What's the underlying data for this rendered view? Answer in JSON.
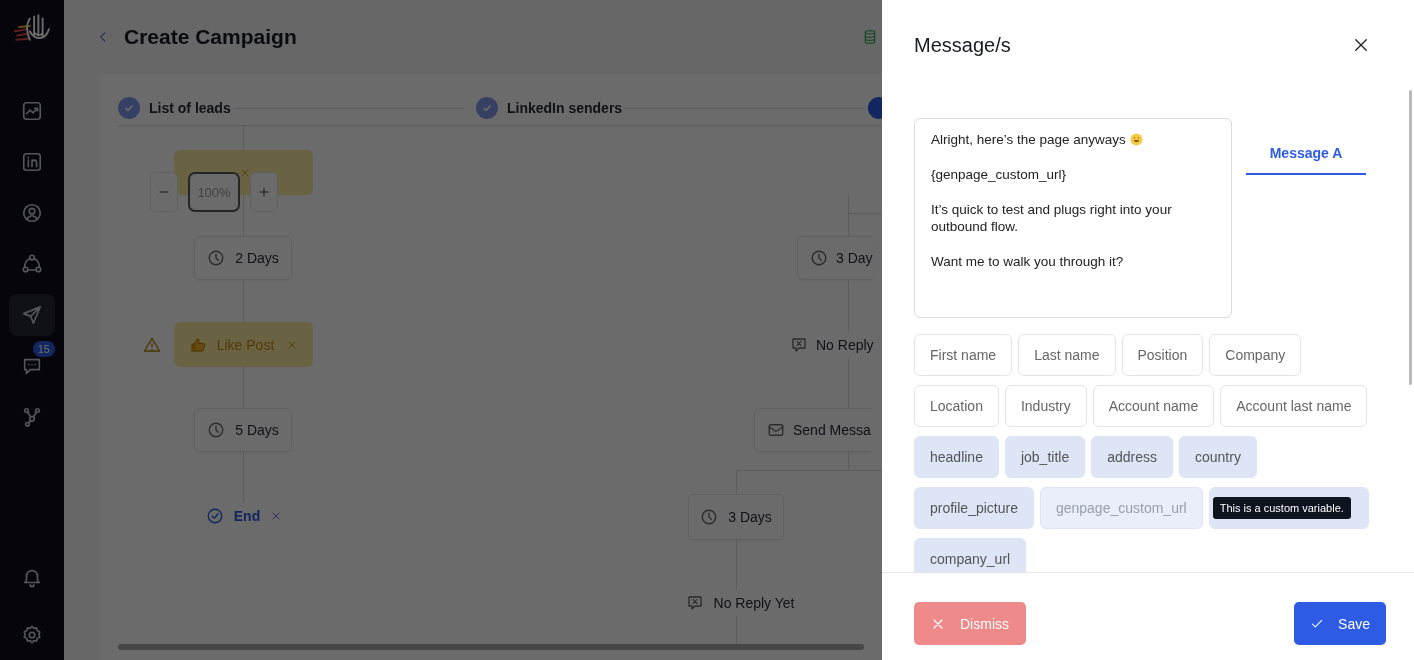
{
  "sidebar": {
    "items": [
      {
        "kind": "chart",
        "selected": false
      },
      {
        "kind": "linkedin",
        "selected": false
      },
      {
        "kind": "user",
        "selected": false
      },
      {
        "kind": "network",
        "selected": false
      },
      {
        "kind": "send",
        "selected": true
      },
      {
        "kind": "chat",
        "selected": false,
        "badge": "15"
      },
      {
        "kind": "branch",
        "selected": false
      },
      {
        "kind": "bell",
        "selected": false
      },
      {
        "kind": "gear",
        "selected": false
      }
    ]
  },
  "page": {
    "title": "Create Campaign"
  },
  "steps": [
    {
      "label": "List of leads",
      "done": true
    },
    {
      "label": "LinkedIn senders",
      "done": true
    },
    {
      "done": false
    }
  ],
  "canvas": {
    "zoom": "100%",
    "nodes": [
      {
        "kind": "action"
      },
      {
        "kind": "delay",
        "label": "2 Days"
      },
      {
        "kind": "action",
        "label": "Like Post",
        "warning": true
      },
      {
        "kind": "delay",
        "label": "5 Days"
      },
      {
        "kind": "end",
        "label": "End"
      },
      {
        "kind": "delay",
        "label": "3 Day"
      },
      {
        "kind": "reply",
        "label": "No Reply"
      },
      {
        "kind": "message",
        "label": "Send Messa"
      },
      {
        "kind": "delay",
        "label": "3 Days"
      },
      {
        "kind": "reply",
        "label": "No Reply Yet"
      }
    ]
  },
  "drawer": {
    "title": "Message/s",
    "message": [
      {
        "text": "Alright, here’s the page anyways",
        "emoji": true
      },
      {
        "text": "{genpage_custom_url}",
        "emoji": false
      },
      {
        "text": "It’s quick to test and plugs right into your outbound flow.",
        "emoji": false
      },
      {
        "text": "Want me to walk you through it?",
        "emoji": false
      }
    ],
    "tabs": [
      {
        "label": "Message A",
        "selected": true
      }
    ],
    "variables": [
      {
        "label": "First name",
        "kind": "field"
      },
      {
        "label": "Last name",
        "kind": "field"
      },
      {
        "label": "Position",
        "kind": "field"
      },
      {
        "label": "Company",
        "kind": "field"
      },
      {
        "label": "Location",
        "kind": "field"
      },
      {
        "label": "Industry",
        "kind": "field"
      },
      {
        "label": "Account name",
        "kind": "field"
      },
      {
        "label": "Account last name",
        "kind": "field"
      },
      {
        "label": "headline",
        "kind": "custom"
      },
      {
        "label": "job_title",
        "kind": "custom"
      },
      {
        "label": "address",
        "kind": "custom"
      },
      {
        "label": "country",
        "kind": "custom"
      },
      {
        "label": "profile_picture",
        "kind": "custom"
      },
      {
        "label": "genpage_custom_url",
        "kind": "custom",
        "faded": true
      },
      {
        "kind": "custom",
        "tooltip": "This is a custom variable."
      },
      {
        "label": "company_url",
        "kind": "custom"
      }
    ],
    "buttons": [
      {
        "label": "Dismiss",
        "kind": "dismiss"
      },
      {
        "label": "Save",
        "kind": "save"
      }
    ]
  }
}
